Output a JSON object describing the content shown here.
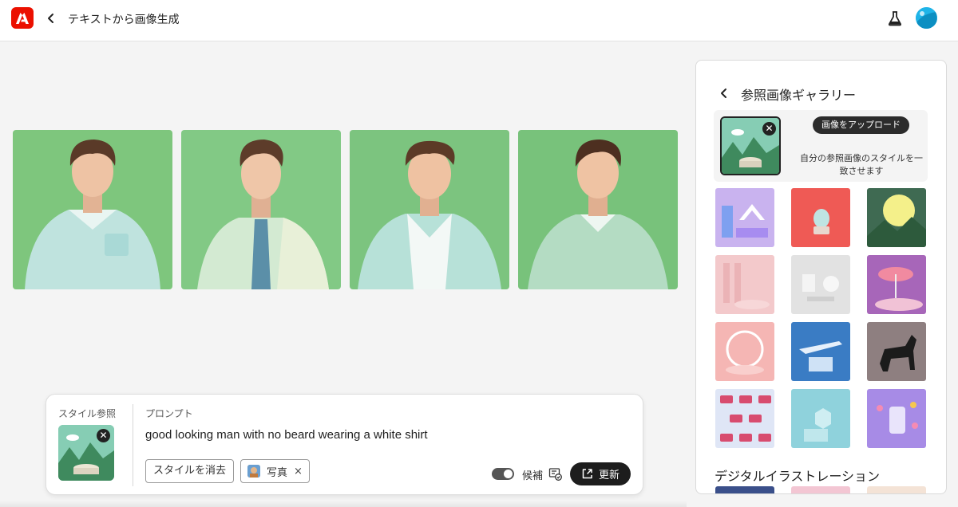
{
  "header": {
    "title": "テキストから画像生成"
  },
  "results": {
    "images": [
      {
        "alt": "man-1"
      },
      {
        "alt": "man-2"
      },
      {
        "alt": "man-3"
      },
      {
        "alt": "man-4"
      }
    ]
  },
  "panel": {
    "title": "参照画像ギャラリー",
    "upload_button": "画像をアップロード",
    "upload_description": "自分の参照画像のスタイルを一致させます",
    "section_title": "デジタルイラストレーション",
    "close_glyph": "✕"
  },
  "prompt_bar": {
    "style_label": "スタイル参照",
    "prompt_label": "プロンプト",
    "prompt_text": "good looking man with no beard wearing a white shirt",
    "clear_style_button": "スタイルを消去",
    "chip_label": "写真",
    "chip_remove": "×",
    "toggle_label": "候補",
    "refresh_button": "更新",
    "close_glyph": "✕"
  },
  "colors": {
    "brand": "#eb1000",
    "avatar": "#1fb4e8",
    "dark_button": "#1d1d1d"
  },
  "icons": {
    "logo": "adobe-logo-icon",
    "back": "chevron-left-icon",
    "labs": "flask-icon",
    "refresh": "refresh-icon",
    "suggest": "suggestion-icon"
  }
}
